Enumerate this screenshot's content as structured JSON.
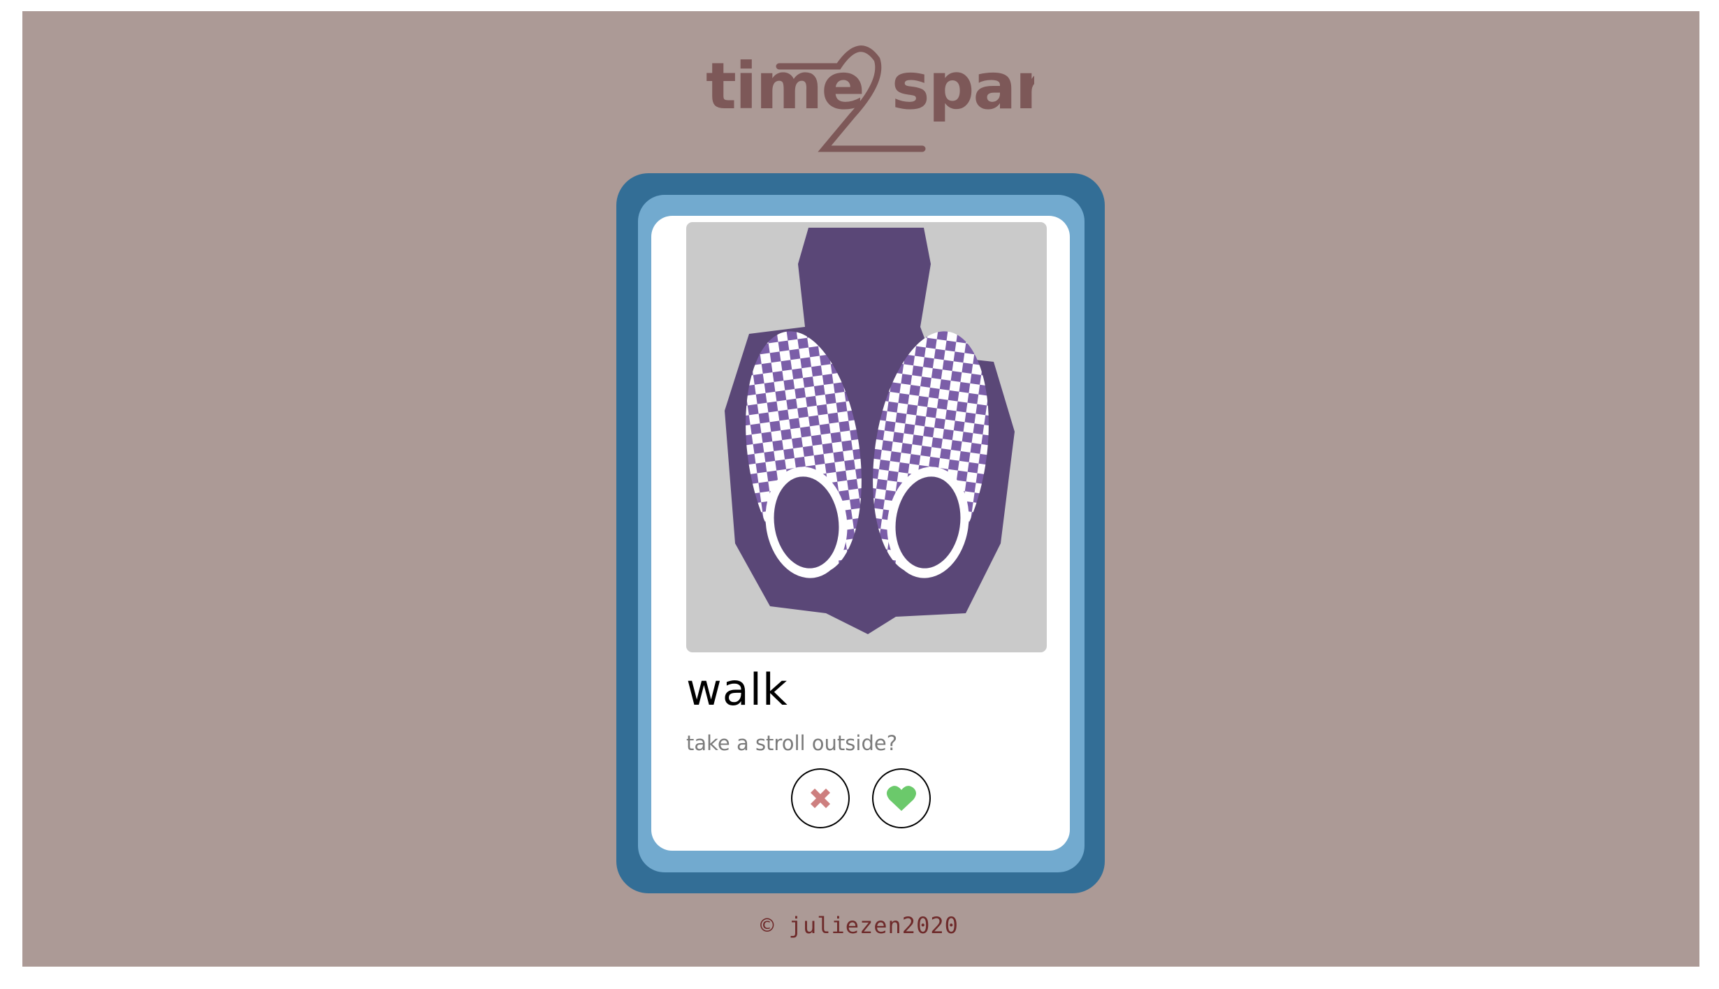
{
  "header": {
    "logo_text": "time2spare",
    "logo_color": "#7d5858"
  },
  "card": {
    "image_subject": "purple checkered slip-on shoes",
    "title": "walk",
    "description": "take a stroll outside?",
    "actions": {
      "reject": {
        "icon": "x-icon",
        "color": "#cd7f7f"
      },
      "like": {
        "icon": "heart-icon",
        "color": "#6bc96b"
      }
    }
  },
  "footer": {
    "copyright": "© juliezen2020"
  },
  "colors": {
    "background": "#ac9a96",
    "card_outer": "#336e96",
    "card_mid": "#72aacf"
  }
}
